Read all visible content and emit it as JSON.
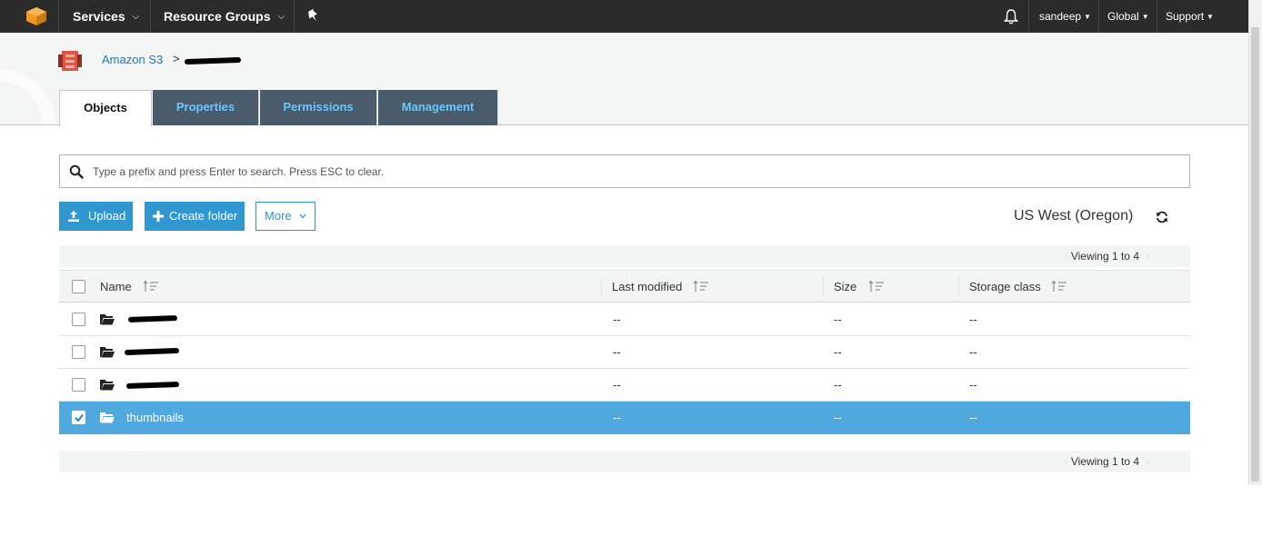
{
  "topnav": {
    "services_label": "Services",
    "resource_groups_label": "Resource Groups",
    "user_label": "sandeep",
    "region_menu_label": "Global",
    "support_label": "Support"
  },
  "breadcrumb": {
    "root_label": "Amazon S3",
    "separator": ">"
  },
  "tabs": [
    {
      "label": "Objects",
      "active": true
    },
    {
      "label": "Properties",
      "active": false
    },
    {
      "label": "Permissions",
      "active": false
    },
    {
      "label": "Management",
      "active": false
    }
  ],
  "search": {
    "placeholder": "Type a prefix and press Enter to search. Press ESC to clear.",
    "value": ""
  },
  "actions": {
    "upload_label": "Upload",
    "create_folder_label": "Create folder",
    "more_label": "More"
  },
  "region": "US West (Oregon)",
  "pager": {
    "top_text": "Viewing 1 to 4",
    "bottom_text": "Viewing 1 to 4"
  },
  "table": {
    "columns": [
      "Name",
      "Last modified",
      "Size",
      "Storage class"
    ],
    "rows": [
      {
        "name": "",
        "last_modified": "--",
        "size": "--",
        "storage_class": "--",
        "checked": false,
        "name_redacted": true
      },
      {
        "name": "",
        "last_modified": "--",
        "size": "--",
        "storage_class": "--",
        "checked": false,
        "name_redacted": true
      },
      {
        "name": "",
        "last_modified": "--",
        "size": "--",
        "storage_class": "--",
        "checked": false,
        "name_redacted": true
      },
      {
        "name": "thumbnails",
        "last_modified": "--",
        "size": "--",
        "storage_class": "--",
        "checked": true,
        "name_redacted": false
      }
    ]
  },
  "colors": {
    "topnav_bg": "#2b2b2b",
    "accent_blue": "#3097d1",
    "link_blue": "#1a7bbf",
    "tab_dark_bg": "#4a5b6b",
    "tab_text": "#66c8ff",
    "selected_row": "#4fa8de",
    "aws_orange": "#f7981d",
    "s3_red": "#e25444"
  },
  "icons": [
    "aws-logo",
    "pin-icon",
    "bell-icon",
    "s3-bucket-icon",
    "search-icon",
    "upload-icon",
    "plus-icon",
    "chevron-down-icon",
    "refresh-icon",
    "sort-icon",
    "folder-icon",
    "checkmark-icon"
  ]
}
